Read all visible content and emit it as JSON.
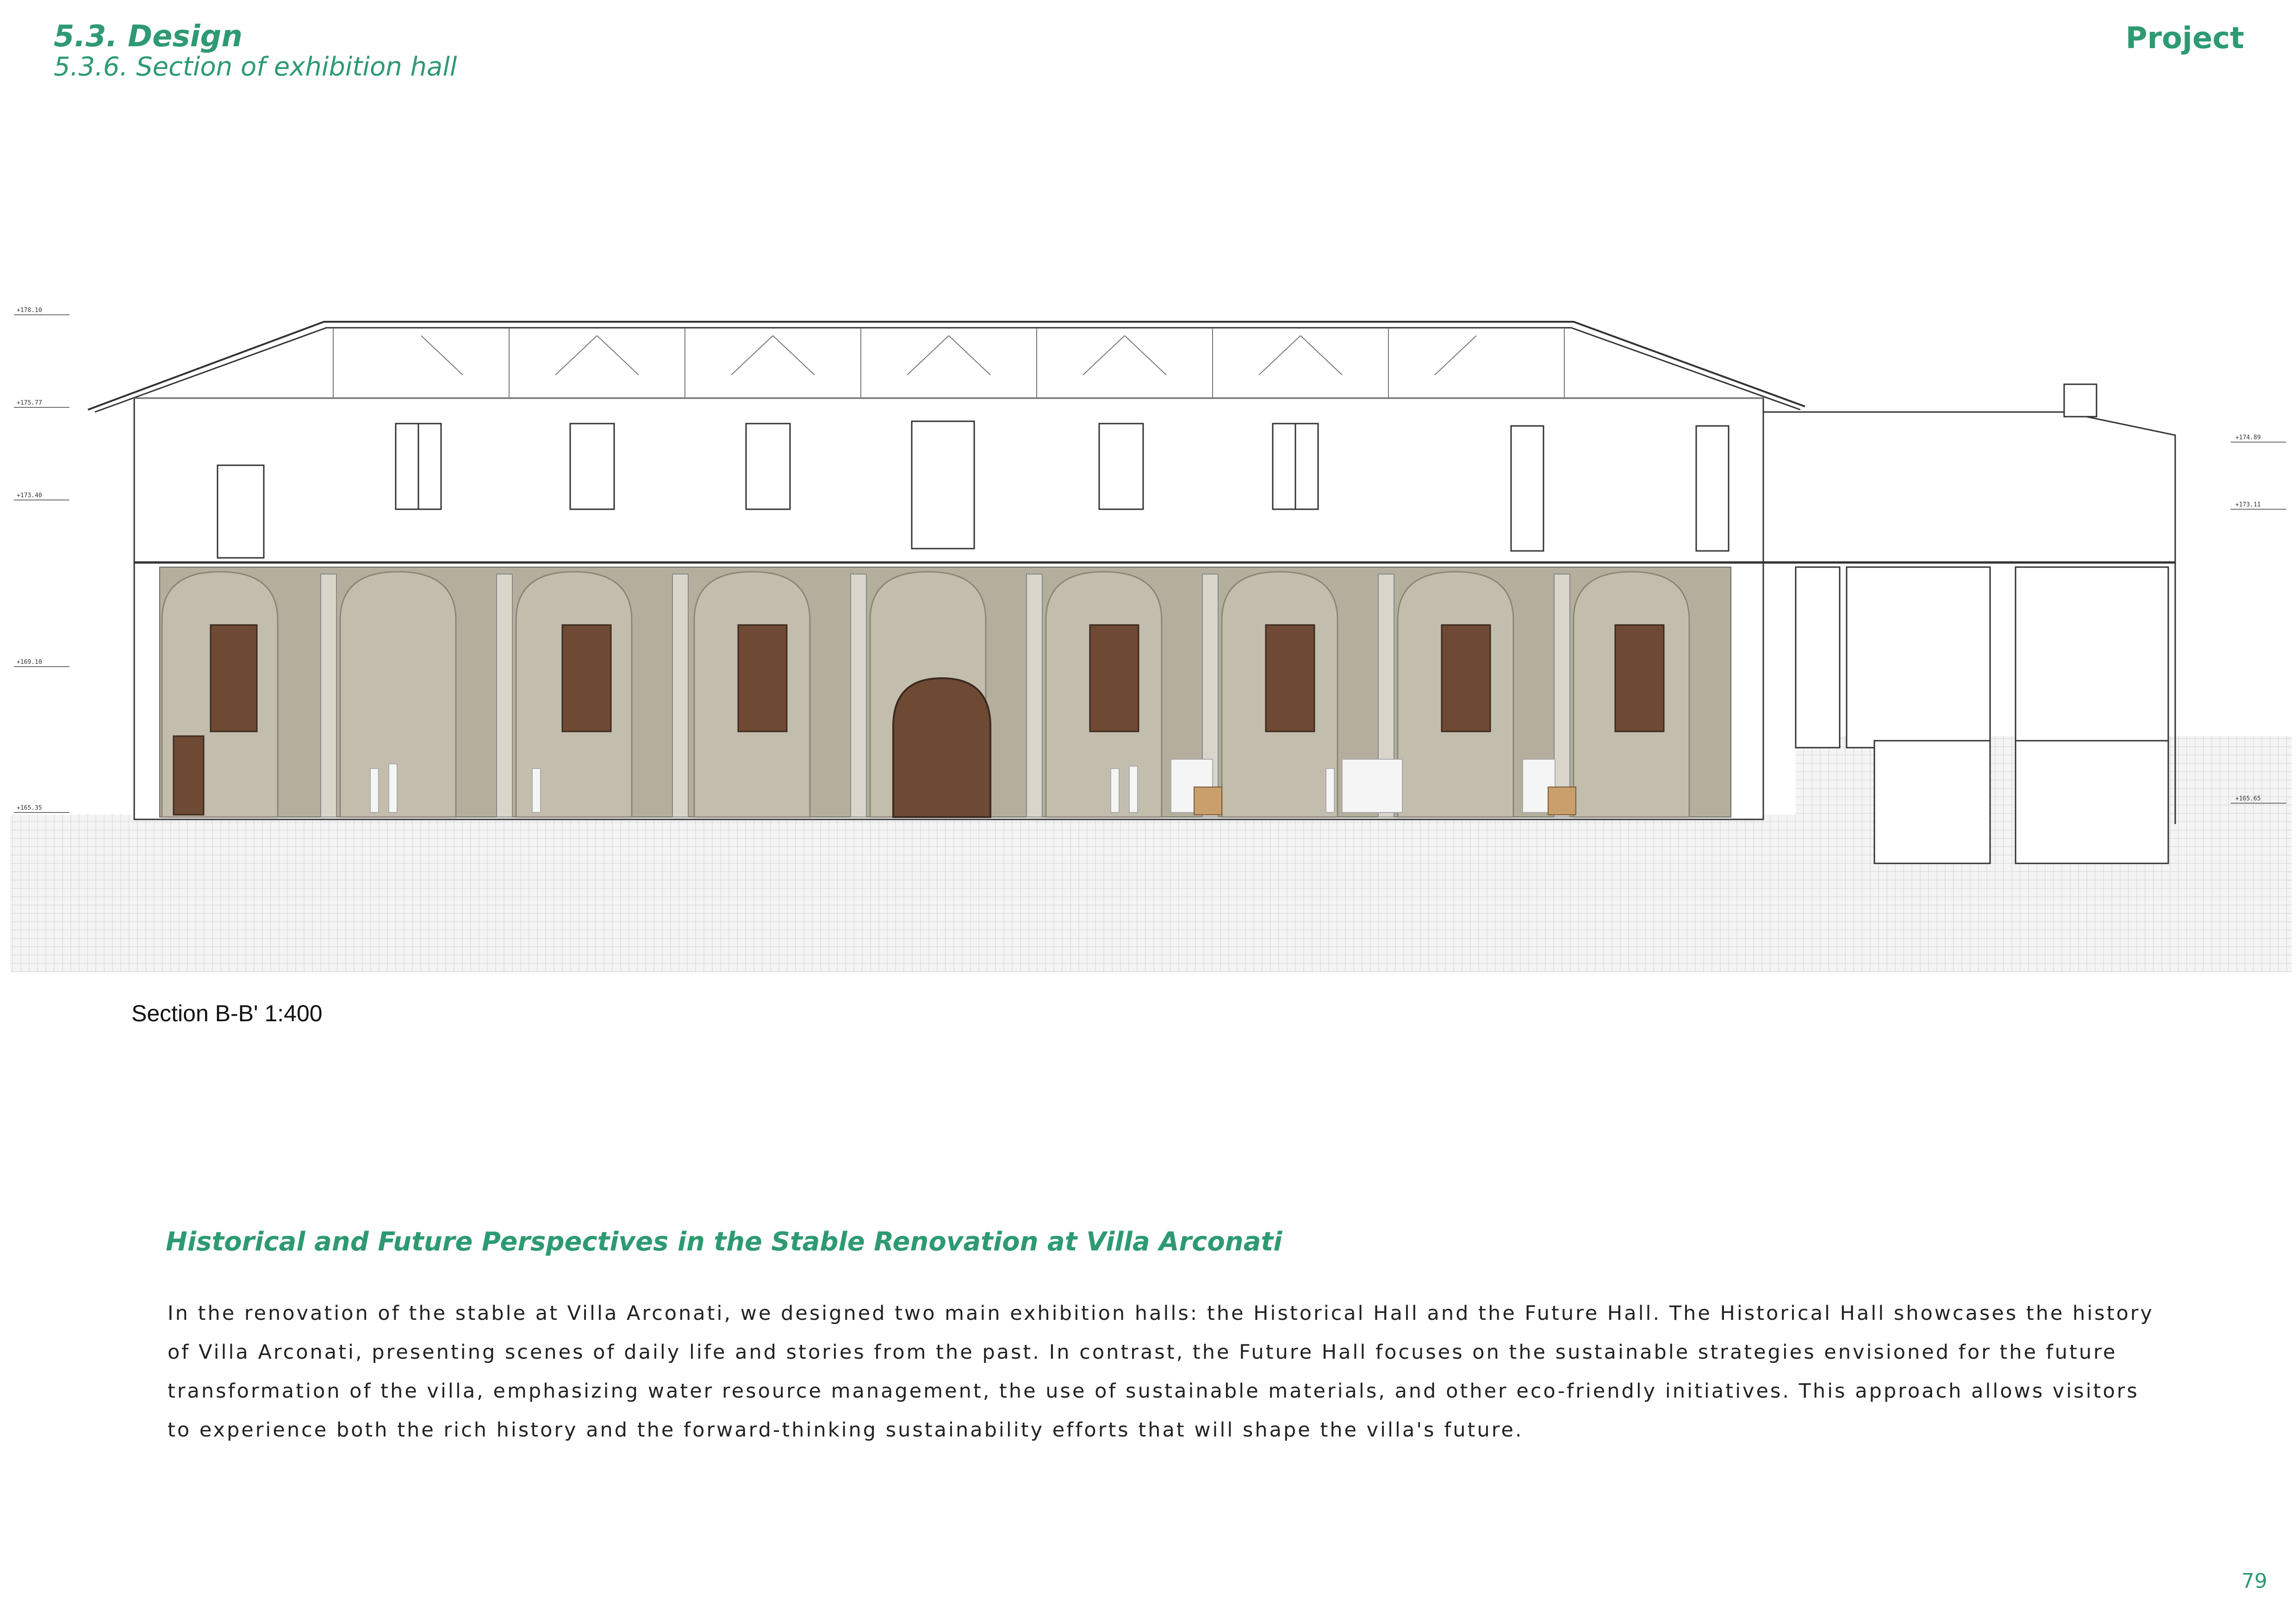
{
  "header": {
    "section_title": "5.3. Design",
    "section_subtitle": "5.3.6. Section of exhibition hall",
    "chapter": "Project"
  },
  "drawing": {
    "caption": "Section B-B' 1:400",
    "levels_left": [
      "+178.10",
      "+175.77",
      "+173.40",
      "+169.10",
      "+165.35"
    ],
    "levels_right": [
      "+174.89",
      "+173.11",
      "+165.65"
    ]
  },
  "text": {
    "heading": "Historical and Future Perspectives in the Stable Renovation at Villa Arconati",
    "body": "In the renovation of the stable at Villa Arconati, we designed two main exhibition halls: the Historical Hall and the Future Hall. The Historical Hall showcases the history of Villa Arconati, presenting scenes of daily life and stories from the past. In contrast, the Future Hall focuses on the sustainable strategies envisioned for the future transformation of the villa, emphasizing water resource management, the use of sustainable materials, and other eco-friendly initiatives. This approach allows visitors to experience both the rich history and the forward-thinking sustainability efforts that will shape the villa's future."
  },
  "footer": {
    "page_number": "79"
  },
  "colors": {
    "accent": "#2e9a72",
    "wall": "#b4ae9d",
    "shutter": "#6e4a35"
  }
}
